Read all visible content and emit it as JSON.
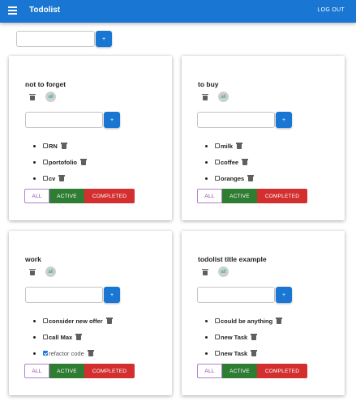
{
  "app": {
    "title": "Todolist",
    "logout_label": "LOG OUT",
    "menu_icon": "menu-icon"
  },
  "new_list": {
    "value": "",
    "placeholder": "",
    "add_label": "+"
  },
  "colors": {
    "primary": "#1976d2",
    "active": "#2e7d32",
    "completed": "#d32f2f",
    "all_outline": "#8e44ad"
  },
  "filters": {
    "all": "ALL",
    "active": "ACTIVE",
    "completed": "COMPLETED"
  },
  "todolists": [
    {
      "title": "not to forget",
      "badge": "all",
      "add_label": "+",
      "tasks": [
        {
          "label": "RN",
          "done": false
        },
        {
          "label": "portofolio",
          "done": false
        },
        {
          "label": "cv",
          "done": false
        }
      ]
    },
    {
      "title": "to buy",
      "badge": "all",
      "add_label": "+",
      "tasks": [
        {
          "label": "milk",
          "done": false
        },
        {
          "label": "coffee",
          "done": false
        },
        {
          "label": "oranges",
          "done": false
        }
      ]
    },
    {
      "title": "work",
      "badge": "all",
      "add_label": "+",
      "tasks": [
        {
          "label": "consider new offer",
          "done": false
        },
        {
          "label": "call Max",
          "done": false
        },
        {
          "label": "refactor code",
          "done": true
        }
      ]
    },
    {
      "title": "todolist title example",
      "badge": "all",
      "add_label": "+",
      "tasks": [
        {
          "label": "could be anything",
          "done": false
        },
        {
          "label": "new Task",
          "done": false
        },
        {
          "label": "new Task",
          "done": false
        }
      ]
    }
  ]
}
